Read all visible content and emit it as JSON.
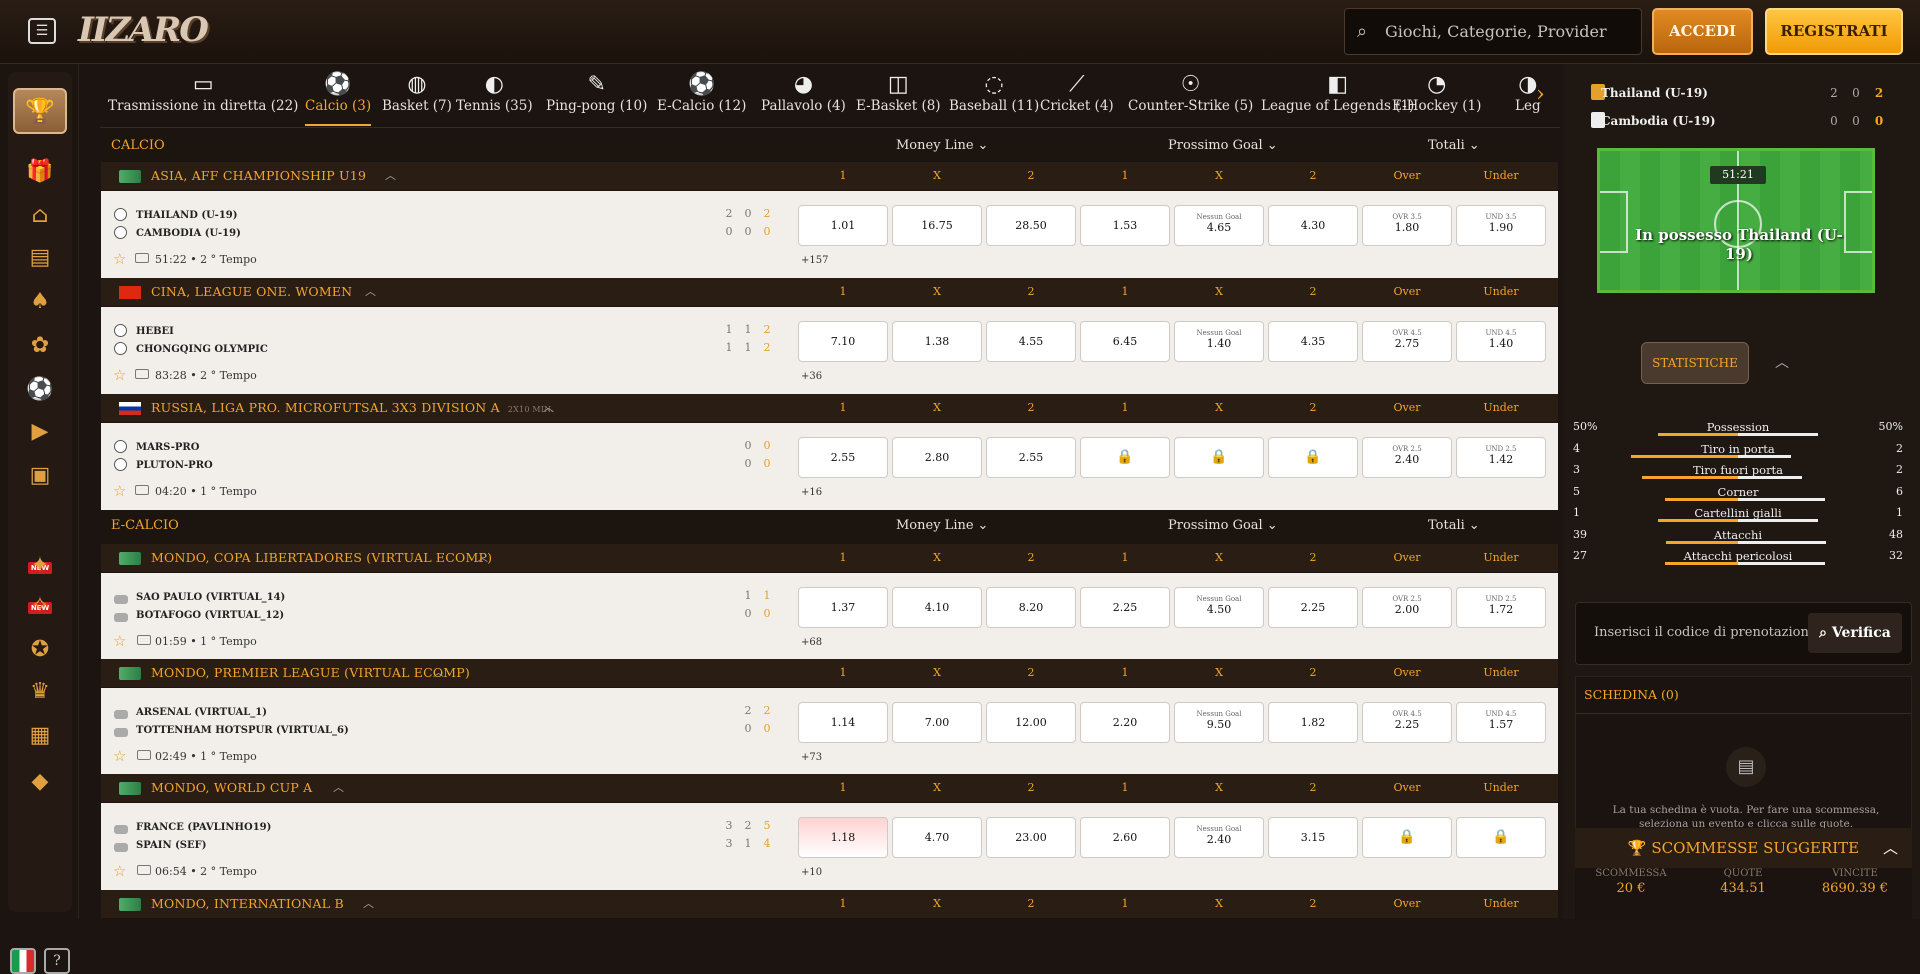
{
  "header": {
    "logo": "IIZARO",
    "search_placeholder": "Giochi, Categorie, Provider",
    "login": "ACCEDI",
    "register": "REGISTRATI"
  },
  "tabs": [
    {
      "label": "Trasmissione in diretta (22)",
      "icon": "tv-icon"
    },
    {
      "label": "Calcio (3)",
      "icon": "soccer-ball-icon"
    },
    {
      "label": "Basket (7)",
      "icon": "basketball-icon"
    },
    {
      "label": "Tennis (35)",
      "icon": "tennis-icon"
    },
    {
      "label": "Ping-pong (10)",
      "icon": "ping-pong-icon"
    },
    {
      "label": "E-Calcio (12)",
      "icon": "e-soccer-icon"
    },
    {
      "label": "Pallavolo (4)",
      "icon": "volleyball-icon"
    },
    {
      "label": "E-Basket (8)",
      "icon": "gamepad-icon"
    },
    {
      "label": "Baseball (11)",
      "icon": "baseball-icon"
    },
    {
      "label": "Cricket (4)",
      "icon": "cricket-icon"
    },
    {
      "label": "Counter-Strike (5)",
      "icon": "counter-strike-icon"
    },
    {
      "label": "League of Legends (1)",
      "icon": "lol-icon"
    },
    {
      "label": "E-Hockey (1)",
      "icon": "hockey-icon"
    },
    {
      "label": "Leg",
      "icon": "league-icon"
    }
  ],
  "sections": {
    "calcio": {
      "title": "CALCIO",
      "money_line": "Money Line",
      "next_goal": "Prossimo Goal",
      "totals": "Totali"
    },
    "ecalcio": {
      "title": "E-CALCIO",
      "money_line": "Money Line",
      "next_goal": "Prossimo Goal",
      "totals": "Totali"
    }
  },
  "cols": [
    "1",
    "X",
    "2",
    "1",
    "X",
    "2",
    "Over",
    "Under"
  ],
  "leagues": [
    {
      "name": "ASIA, AFF CHAMPIONSHIP U19",
      "note": "",
      "home": "THAILAND (U-19)",
      "away": "CAMBODIA (U-19)",
      "hs": [
        "2",
        "0",
        "2"
      ],
      "as": [
        "0",
        "0",
        "0"
      ],
      "time": "51:22 • 2 ° Tempo",
      "more": "+157",
      "odds": [
        "1.01",
        "16.75",
        "28.50",
        "1.53",
        "4.65",
        "4.30",
        "1.80",
        "1.90"
      ],
      "ng": "Nessun Goal",
      "ovr": "OVR 3.5",
      "und": "UND 3.5"
    },
    {
      "name": "CINA, LEAGUE ONE. WOMEN",
      "note": "",
      "home": "HEBEI",
      "away": "CHONGQING OLYMPIC",
      "hs": [
        "1",
        "1",
        "2"
      ],
      "as": [
        "1",
        "1",
        "2"
      ],
      "time": "83:28 • 2 ° Tempo",
      "more": "+36",
      "odds": [
        "7.10",
        "1.38",
        "4.55",
        "6.45",
        "1.40",
        "4.35",
        "2.75",
        "1.40"
      ],
      "ng": "Nessun Goal",
      "ovr": "OVR 4.5",
      "und": "UND 4.5"
    },
    {
      "name": "RUSSIA, LIGA PRO. MICROFUTSAL 3X3 DIVISION A",
      "note": "2X10 MIN.",
      "home": "MARS-PRO",
      "away": "PLUTON-PRO",
      "hs": [
        "0",
        "0"
      ],
      "as": [
        "0",
        "0"
      ],
      "time": "04:20 • 1 ° Tempo",
      "more": "+16",
      "odds": [
        "2.55",
        "2.80",
        "2.55",
        "",
        "",
        "",
        "2.40",
        "1.42"
      ],
      "ng": "",
      "ovr": "OVR 2.5",
      "und": "UND 2.5"
    },
    {
      "name": "MONDO, COPA LIBERTADORES (VIRTUAL ECOMP)",
      "note": "",
      "home": "SAO PAULO (VIRTUAL_14)",
      "away": "BOTAFOGO (VIRTUAL_12)",
      "hs": [
        "1",
        "1"
      ],
      "as": [
        "0",
        "0"
      ],
      "time": "01:59 • 1 ° Tempo",
      "more": "+68",
      "odds": [
        "1.37",
        "4.10",
        "8.20",
        "2.25",
        "4.50",
        "2.25",
        "2.00",
        "1.72"
      ],
      "ng": "Nessun Goal",
      "ovr": "OVR 2.5",
      "und": "UND 2.5"
    },
    {
      "name": "MONDO, PREMIER LEAGUE (VIRTUAL ECOMP)",
      "note": "",
      "home": "ARSENAL (VIRTUAL_1)",
      "away": "TOTTENHAM HOTSPUR (VIRTUAL_6)",
      "hs": [
        "2",
        "2"
      ],
      "as": [
        "0",
        "0"
      ],
      "time": "02:49 • 1 ° Tempo",
      "more": "+73",
      "odds": [
        "1.14",
        "7.00",
        "12.00",
        "2.20",
        "9.50",
        "1.82",
        "2.25",
        "1.57"
      ],
      "ng": "Nessun Goal",
      "ovr": "OVR 4.5",
      "und": "UND 4.5"
    },
    {
      "name": "MONDO, WORLD CUP A",
      "note": "",
      "home": "FRANCE (PAVLINHO19)",
      "away": "SPAIN (SEF)",
      "hs": [
        "3",
        "2",
        "5"
      ],
      "as": [
        "3",
        "1",
        "4"
      ],
      "time": "06:54 • 2 ° Tempo",
      "more": "+10",
      "odds": [
        "1.18",
        "4.70",
        "23.00",
        "2.60",
        "2.40",
        "3.15",
        "",
        ""
      ],
      "ng": "Nessun Goal",
      "ovr": "",
      "und": ""
    },
    {
      "name": "MONDO, INTERNATIONAL B",
      "note": ""
    }
  ],
  "right": {
    "home": "Thailand (U-19)",
    "away": "Cambodia (U-19)",
    "hsc": [
      "2",
      "0",
      "2"
    ],
    "asc": [
      "0",
      "0",
      "0"
    ],
    "clock": "51:21",
    "possession": "In possesso Thailand (U-19)",
    "stats_btn": "STATISTICHE",
    "stats": [
      {
        "name": "Possession",
        "l": "50%",
        "r": "50%",
        "lv": 50,
        "rv": 50
      },
      {
        "name": "Tiro in porta",
        "l": "4",
        "r": "2",
        "lv": 4,
        "rv": 2
      },
      {
        "name": "Tiro fuori porta",
        "l": "3",
        "r": "2",
        "lv": 3,
        "rv": 2
      },
      {
        "name": "Corner",
        "l": "5",
        "r": "6",
        "lv": 5,
        "rv": 6
      },
      {
        "name": "Cartellini gialli",
        "l": "1",
        "r": "1",
        "lv": 1,
        "rv": 1
      },
      {
        "name": "Attacchi",
        "l": "39",
        "r": "48",
        "lv": 39,
        "rv": 48
      },
      {
        "name": "Attacchi pericolosi",
        "l": "27",
        "r": "32",
        "lv": 27,
        "rv": 32
      }
    ],
    "coupon_placeholder": "Inserisci il codice di prenotazion",
    "verify": "Verifica",
    "slip_title": "SCHEDINA (0)",
    "slip_msg": "La tua schedina è vuota. Per fare una scommessa, seleziona un evento e clicca sulle quote.",
    "suggested": "SCOMMESSE SUGGERITE",
    "sugg_labels": [
      "SCOMMESSA",
      "QUOTE",
      "VINCITE"
    ],
    "sugg_vals": [
      "20 €",
      "434.51",
      "8690.39 €"
    ]
  }
}
